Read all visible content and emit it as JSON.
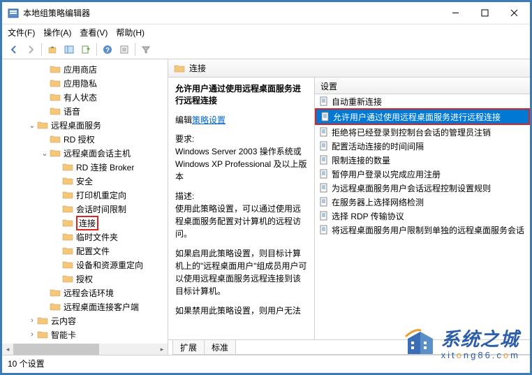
{
  "window": {
    "title": "本地组策略编辑器"
  },
  "menu": {
    "file": "文件(F)",
    "action": "操作(A)",
    "view": "查看(V)",
    "help": "帮助(H)"
  },
  "tree": {
    "items": [
      {
        "depth": 3,
        "expand": "",
        "label": "应用商店"
      },
      {
        "depth": 3,
        "expand": "",
        "label": "应用隐私"
      },
      {
        "depth": 3,
        "expand": "",
        "label": "有人状态"
      },
      {
        "depth": 3,
        "expand": "",
        "label": "语音"
      },
      {
        "depth": 2,
        "expand": "v",
        "label": "远程桌面服务"
      },
      {
        "depth": 3,
        "expand": "",
        "label": "RD 授权"
      },
      {
        "depth": 3,
        "expand": "v",
        "label": "远程桌面会话主机"
      },
      {
        "depth": 4,
        "expand": "",
        "label": "RD 连接 Broker"
      },
      {
        "depth": 4,
        "expand": "",
        "label": "安全"
      },
      {
        "depth": 4,
        "expand": "",
        "label": "打印机重定向"
      },
      {
        "depth": 4,
        "expand": "",
        "label": "会话时间限制"
      },
      {
        "depth": 4,
        "expand": "",
        "label": "连接",
        "selected": true
      },
      {
        "depth": 4,
        "expand": "",
        "label": "临时文件夹"
      },
      {
        "depth": 4,
        "expand": "",
        "label": "配置文件"
      },
      {
        "depth": 4,
        "expand": "",
        "label": "设备和资源重定向"
      },
      {
        "depth": 4,
        "expand": "",
        "label": "授权"
      },
      {
        "depth": 3,
        "expand": "",
        "label": "远程会话环境"
      },
      {
        "depth": 3,
        "expand": "",
        "label": "远程桌面连接客户端"
      },
      {
        "depth": 2,
        "expand": ">",
        "label": "云内容"
      },
      {
        "depth": 2,
        "expand": ">",
        "label": "智能卡"
      }
    ]
  },
  "right": {
    "header": "连接",
    "desc_title": "允许用户通过使用远程桌面服务进行远程连接",
    "edit_prefix": "编辑",
    "edit_link": "策略设置",
    "req_label": "要求:",
    "req_text": "Windows Server 2003 操作系统或 Windows XP Professional 及以上版本",
    "desc_label": "描述:",
    "desc_p1": "使用此策略设置，可以通过使用远程桌面服务配置对计算机的远程访问。",
    "desc_p2": "如果启用此策略设置，则目标计算机上的\"远程桌面用户\"组成员用户可以使用远程桌面服务远程连接到该目标计算机。",
    "desc_p3": "如果禁用此策略设置，则用户无法",
    "settings_header": "设置",
    "settings": [
      {
        "label": "自动重新连接"
      },
      {
        "label": "允许用户通过使用远程桌面服务进行远程连接",
        "selected": true
      },
      {
        "label": "拒绝将已经登录到控制台会话的管理员注销"
      },
      {
        "label": "配置活动连接的时间间隔"
      },
      {
        "label": "限制连接的数量"
      },
      {
        "label": "暂停用户登录以完成应用注册"
      },
      {
        "label": "为远程桌面服务用户会话远程控制设置规则"
      },
      {
        "label": "在服务器上选择网络检测"
      },
      {
        "label": "选择 RDP 传输协议"
      },
      {
        "label": "将远程桌面服务用户限制到单独的远程桌面服务会话"
      }
    ],
    "tabs": {
      "extended": "扩展",
      "standard": "标准"
    }
  },
  "status": "10 个设置",
  "watermark": {
    "main": "系统之城",
    "sub_parts": [
      "xit",
      "o",
      "ng86.c",
      "o",
      "m"
    ]
  }
}
